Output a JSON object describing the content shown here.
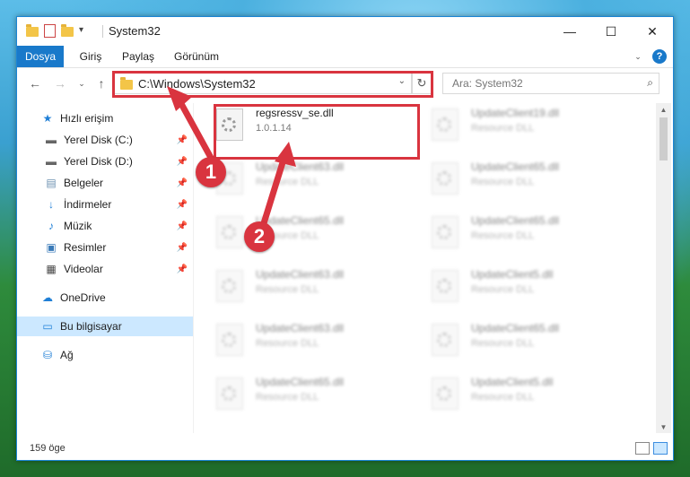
{
  "window": {
    "title": "System32",
    "controls": {
      "minimize": "—",
      "maximize": "☐",
      "close": "✕"
    }
  },
  "ribbon": {
    "tabs": [
      {
        "label": "Dosya"
      },
      {
        "label": "Giriş"
      },
      {
        "label": "Paylaş"
      },
      {
        "label": "Görünüm"
      }
    ],
    "help": "?"
  },
  "address": {
    "path": "C:\\Windows\\System32",
    "search_placeholder": "Ara: System32"
  },
  "sidebar": {
    "quick_access": "Hızlı erişim",
    "pinned": [
      {
        "label": "Yerel Disk (C:)",
        "icon": "drive-icon"
      },
      {
        "label": "Yerel Disk (D:)",
        "icon": "drive-icon"
      },
      {
        "label": "Belgeler",
        "icon": "documents-icon"
      },
      {
        "label": "İndirmeler",
        "icon": "downloads-icon"
      },
      {
        "label": "Müzik",
        "icon": "music-icon"
      },
      {
        "label": "Resimler",
        "icon": "pictures-icon"
      },
      {
        "label": "Videolar",
        "icon": "videos-icon"
      }
    ],
    "onedrive": "OneDrive",
    "this_pc": "Bu bilgisayar",
    "network": "Ağ"
  },
  "files": {
    "highlighted": {
      "name": "regsressv_se.dll",
      "version": "1.0.1.14"
    },
    "blurred": [
      {
        "name": "UpdateClient19.dll",
        "sub": "Resource DLL"
      },
      {
        "name": "UpdateClient63.dll",
        "sub": "Resource DLL"
      },
      {
        "name": "UpdateClient65.dll",
        "sub": "Resource DLL"
      },
      {
        "name": "UpdateClient65.dll",
        "sub": "Resource DLL"
      },
      {
        "name": "UpdateClient65.dll",
        "sub": "Resource DLL"
      },
      {
        "name": "UpdateClient63.dll",
        "sub": "Resource DLL"
      },
      {
        "name": "UpdateClient5.dll",
        "sub": "Resource DLL"
      },
      {
        "name": "UpdateClient63.dll",
        "sub": "Resource DLL"
      },
      {
        "name": "UpdateClient65.dll",
        "sub": "Resource DLL"
      },
      {
        "name": "UpdateClient65.dll",
        "sub": "Resource DLL"
      },
      {
        "name": "UpdateClient5.dll",
        "sub": "Resource DLL"
      }
    ]
  },
  "status": {
    "count": "159 öge"
  },
  "annotations": {
    "step1": "1",
    "step2": "2",
    "color": "#d9343f"
  }
}
